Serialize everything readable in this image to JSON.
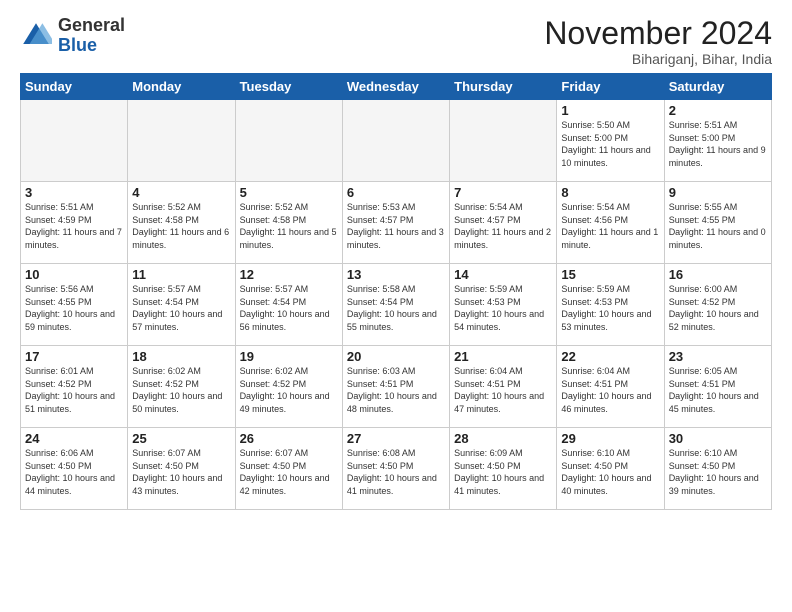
{
  "logo": {
    "general": "General",
    "blue": "Blue"
  },
  "header": {
    "month": "November 2024",
    "location": "Bihariganj, Bihar, India"
  },
  "weekdays": [
    "Sunday",
    "Monday",
    "Tuesday",
    "Wednesday",
    "Thursday",
    "Friday",
    "Saturday"
  ],
  "weeks": [
    [
      {
        "day": "",
        "info": "",
        "empty": true
      },
      {
        "day": "",
        "info": "",
        "empty": true
      },
      {
        "day": "",
        "info": "",
        "empty": true
      },
      {
        "day": "",
        "info": "",
        "empty": true
      },
      {
        "day": "",
        "info": "",
        "empty": true
      },
      {
        "day": "1",
        "info": "Sunrise: 5:50 AM\nSunset: 5:00 PM\nDaylight: 11 hours and 10 minutes."
      },
      {
        "day": "2",
        "info": "Sunrise: 5:51 AM\nSunset: 5:00 PM\nDaylight: 11 hours and 9 minutes."
      }
    ],
    [
      {
        "day": "3",
        "info": "Sunrise: 5:51 AM\nSunset: 4:59 PM\nDaylight: 11 hours and 7 minutes."
      },
      {
        "day": "4",
        "info": "Sunrise: 5:52 AM\nSunset: 4:58 PM\nDaylight: 11 hours and 6 minutes."
      },
      {
        "day": "5",
        "info": "Sunrise: 5:52 AM\nSunset: 4:58 PM\nDaylight: 11 hours and 5 minutes."
      },
      {
        "day": "6",
        "info": "Sunrise: 5:53 AM\nSunset: 4:57 PM\nDaylight: 11 hours and 3 minutes."
      },
      {
        "day": "7",
        "info": "Sunrise: 5:54 AM\nSunset: 4:57 PM\nDaylight: 11 hours and 2 minutes."
      },
      {
        "day": "8",
        "info": "Sunrise: 5:54 AM\nSunset: 4:56 PM\nDaylight: 11 hours and 1 minute."
      },
      {
        "day": "9",
        "info": "Sunrise: 5:55 AM\nSunset: 4:55 PM\nDaylight: 11 hours and 0 minutes."
      }
    ],
    [
      {
        "day": "10",
        "info": "Sunrise: 5:56 AM\nSunset: 4:55 PM\nDaylight: 10 hours and 59 minutes."
      },
      {
        "day": "11",
        "info": "Sunrise: 5:57 AM\nSunset: 4:54 PM\nDaylight: 10 hours and 57 minutes."
      },
      {
        "day": "12",
        "info": "Sunrise: 5:57 AM\nSunset: 4:54 PM\nDaylight: 10 hours and 56 minutes."
      },
      {
        "day": "13",
        "info": "Sunrise: 5:58 AM\nSunset: 4:54 PM\nDaylight: 10 hours and 55 minutes."
      },
      {
        "day": "14",
        "info": "Sunrise: 5:59 AM\nSunset: 4:53 PM\nDaylight: 10 hours and 54 minutes."
      },
      {
        "day": "15",
        "info": "Sunrise: 5:59 AM\nSunset: 4:53 PM\nDaylight: 10 hours and 53 minutes."
      },
      {
        "day": "16",
        "info": "Sunrise: 6:00 AM\nSunset: 4:52 PM\nDaylight: 10 hours and 52 minutes."
      }
    ],
    [
      {
        "day": "17",
        "info": "Sunrise: 6:01 AM\nSunset: 4:52 PM\nDaylight: 10 hours and 51 minutes."
      },
      {
        "day": "18",
        "info": "Sunrise: 6:02 AM\nSunset: 4:52 PM\nDaylight: 10 hours and 50 minutes."
      },
      {
        "day": "19",
        "info": "Sunrise: 6:02 AM\nSunset: 4:52 PM\nDaylight: 10 hours and 49 minutes."
      },
      {
        "day": "20",
        "info": "Sunrise: 6:03 AM\nSunset: 4:51 PM\nDaylight: 10 hours and 48 minutes."
      },
      {
        "day": "21",
        "info": "Sunrise: 6:04 AM\nSunset: 4:51 PM\nDaylight: 10 hours and 47 minutes."
      },
      {
        "day": "22",
        "info": "Sunrise: 6:04 AM\nSunset: 4:51 PM\nDaylight: 10 hours and 46 minutes."
      },
      {
        "day": "23",
        "info": "Sunrise: 6:05 AM\nSunset: 4:51 PM\nDaylight: 10 hours and 45 minutes."
      }
    ],
    [
      {
        "day": "24",
        "info": "Sunrise: 6:06 AM\nSunset: 4:50 PM\nDaylight: 10 hours and 44 minutes."
      },
      {
        "day": "25",
        "info": "Sunrise: 6:07 AM\nSunset: 4:50 PM\nDaylight: 10 hours and 43 minutes."
      },
      {
        "day": "26",
        "info": "Sunrise: 6:07 AM\nSunset: 4:50 PM\nDaylight: 10 hours and 42 minutes."
      },
      {
        "day": "27",
        "info": "Sunrise: 6:08 AM\nSunset: 4:50 PM\nDaylight: 10 hours and 41 minutes."
      },
      {
        "day": "28",
        "info": "Sunrise: 6:09 AM\nSunset: 4:50 PM\nDaylight: 10 hours and 41 minutes."
      },
      {
        "day": "29",
        "info": "Sunrise: 6:10 AM\nSunset: 4:50 PM\nDaylight: 10 hours and 40 minutes."
      },
      {
        "day": "30",
        "info": "Sunrise: 6:10 AM\nSunset: 4:50 PM\nDaylight: 10 hours and 39 minutes."
      }
    ]
  ]
}
